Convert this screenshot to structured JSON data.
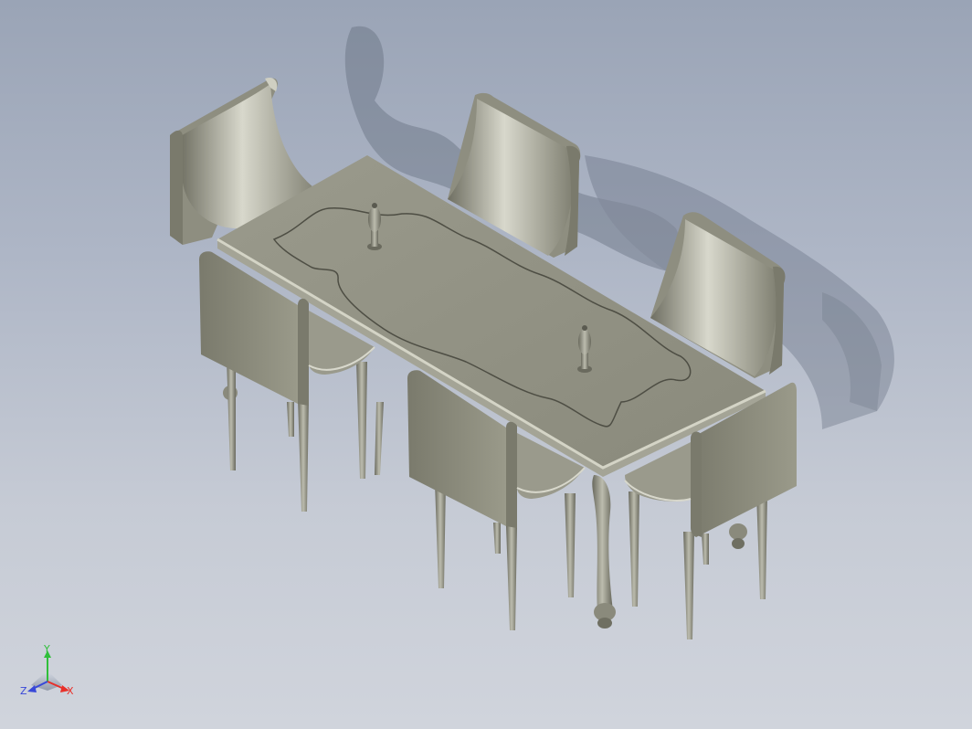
{
  "viewport": {
    "background_top": "#9aa4b6",
    "background_bottom": "#d0d4dc",
    "model_color": "#8c8c7c"
  },
  "triad": {
    "x_label": "X",
    "y_label": "Y",
    "z_label": "Z",
    "x_color": "#e8302a",
    "y_color": "#2fbf3a",
    "z_color": "#3848d8"
  }
}
